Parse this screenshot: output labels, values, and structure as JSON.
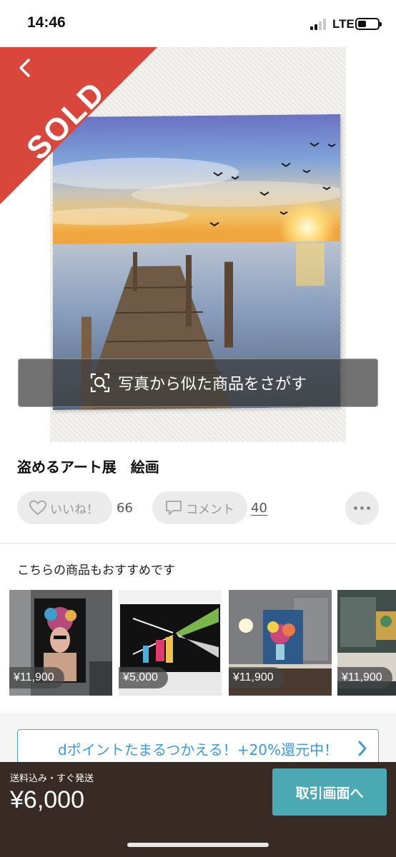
{
  "status_bar": {
    "time": "14:46",
    "network": "LTE"
  },
  "hero": {
    "sold_label": "SOLD",
    "similar_search_label": "写真から似た商品をさがす"
  },
  "item": {
    "title": "盗めるアート展　絵画",
    "like_label": "いいね！",
    "like_count": "66",
    "comment_label": "コメント",
    "comment_count": "40"
  },
  "recommendations": {
    "heading": "こちらの商品もおすすめです",
    "items": [
      {
        "price": "¥11,900"
      },
      {
        "price": "¥5,000"
      },
      {
        "price": "¥11,900"
      },
      {
        "price": "¥11,900"
      }
    ]
  },
  "promo": {
    "dpoint_label": "dポイントたまるつかえる！+20%還元中！"
  },
  "footer": {
    "shipping_note": "送料込み・すぐ発送",
    "price": "¥6,000",
    "trade_button": "取引画面へ"
  },
  "colors": {
    "sold_red": "#d9463c",
    "trade_teal": "#4aa9b3",
    "footer_brown": "#382a25",
    "dpoint_blue": "#3a9ae0"
  }
}
